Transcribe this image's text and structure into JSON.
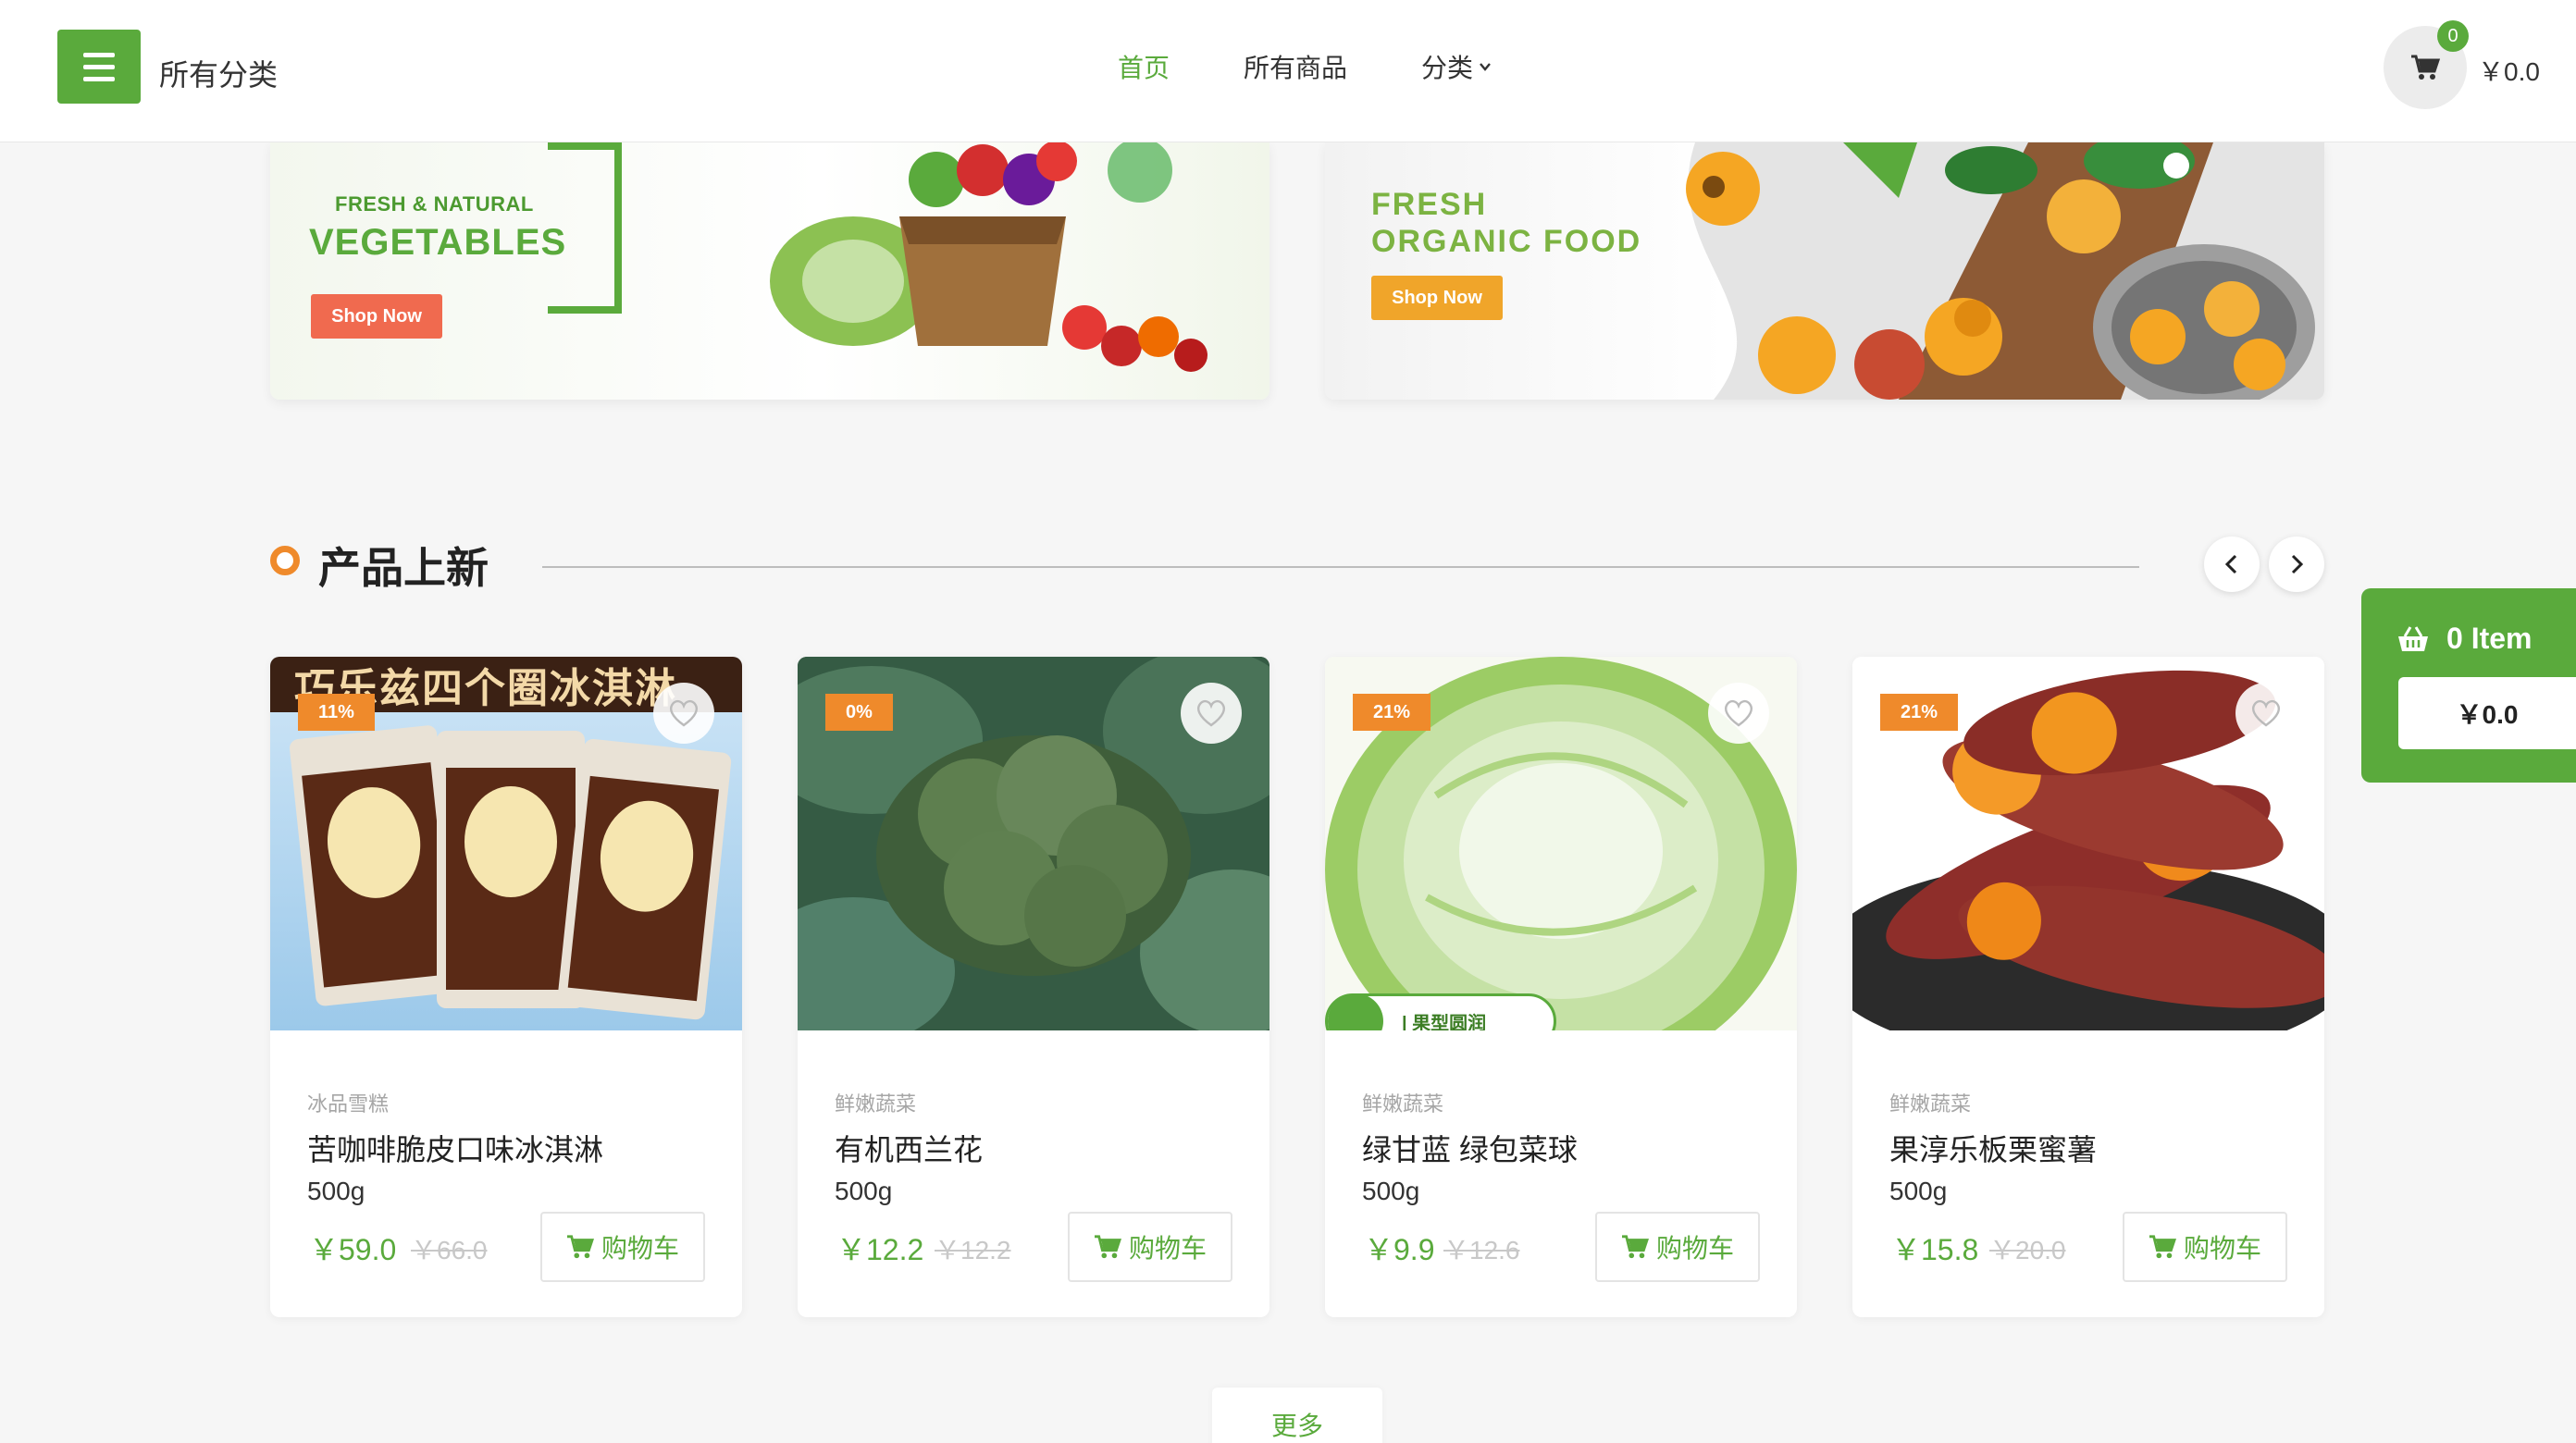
{
  "colors": {
    "accent": "#5aaa3c",
    "orange": "#ef8a2b"
  },
  "header": {
    "menu_icon": "hamburger-icon",
    "category_title": "所有分类",
    "nav": [
      {
        "label": "首页",
        "active": true
      },
      {
        "label": "所有商品",
        "active": false
      },
      {
        "label": "分类",
        "active": false,
        "icon": "chevron-down-icon"
      }
    ],
    "cart_count": "0",
    "cart_total": "￥0.0"
  },
  "banners": [
    {
      "subtitle": "FRESH & NATURAL",
      "title": "VEGETABLES",
      "button": "Shop Now"
    },
    {
      "title_line1": "FRESH",
      "title_line2": "ORGANIC FOOD",
      "button": "Shop Now"
    }
  ],
  "section": {
    "title": "产品上新",
    "prev_icon": "chevron-left-icon",
    "next_icon": "chevron-right-icon"
  },
  "float_cart": {
    "items": "0 Item",
    "total": "￥0.0",
    "icon": "basket-icon"
  },
  "products": [
    {
      "discount": "11%",
      "category": "冰品雪糕",
      "name": "苦咖啡脆皮口味冰淇淋",
      "weight": "500g",
      "price": "￥59.0",
      "old_price": "￥66.0",
      "button": "购物车",
      "image_text": "巧乐兹四个圈冰淇淋"
    },
    {
      "discount": "0%",
      "category": "鲜嫩蔬菜",
      "name": "有机西兰花",
      "weight": "500g",
      "price": "￥12.2",
      "old_price": "￥12.2",
      "button": "购物车"
    },
    {
      "discount": "21%",
      "category": "鲜嫩蔬菜",
      "name": "绿甘蓝 绿包菜球",
      "weight": "500g",
      "price": "￥9.9",
      "old_price": "￥12.6",
      "button": "购物车",
      "image_text": "| 果型圆润"
    },
    {
      "discount": "21%",
      "category": "鲜嫩蔬菜",
      "name": "果淳乐板栗蜜薯",
      "weight": "500g",
      "price": "￥15.8",
      "old_price": "￥20.0",
      "button": "购物车"
    }
  ],
  "more": "更多"
}
